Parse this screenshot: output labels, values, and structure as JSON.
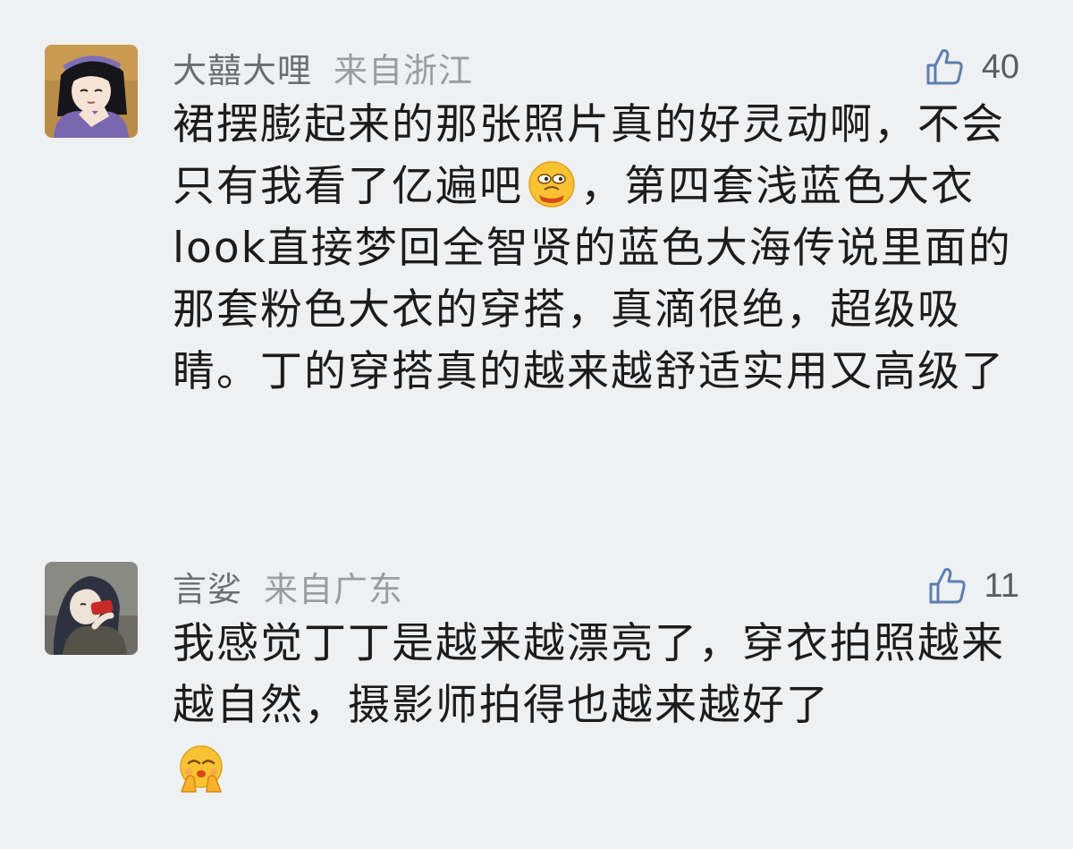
{
  "comments": [
    {
      "username": "大囍大哩",
      "location": "来自浙江",
      "likes": "40",
      "text_part1": "裙摆膨起来的那张照片真的好灵动啊，不会只有我看了亿遍吧",
      "emoji": "smirk-face-emoji",
      "text_part2": "，第四套浅蓝色大衣look直接梦回全智贤的蓝色大海传说里面的那套粉色大衣的穿搭，真滴很绝，超级吸睛。丁的穿搭真的越来越舒适实用又高级了",
      "avatar": "anime-girl-avatar"
    },
    {
      "username": "言娑",
      "location": "来自广东",
      "likes": "11",
      "text_part1": "我感觉丁丁是越来越漂亮了，穿衣拍照越来越自然，摄影师拍得也越来越好了",
      "emoji": "pleading-hands-face-emoji",
      "avatar": "anime-drinking-avatar"
    }
  ],
  "colors": {
    "background": "#eff0f2",
    "username": "#6b6d70",
    "location": "#9a9ca0",
    "like_icon": "#5b7fb0",
    "text": "#1c1c1c"
  },
  "icons": {
    "like": "thumbs-up-icon"
  }
}
